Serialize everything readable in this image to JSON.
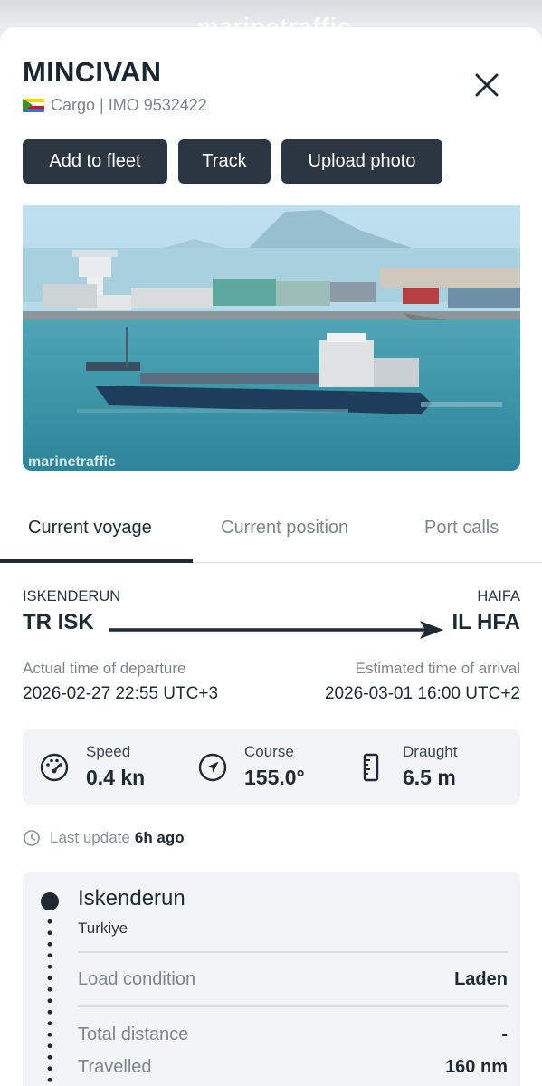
{
  "watermark_top": "marinetraffic",
  "vessel": {
    "name": "MINCIVAN",
    "type": "Cargo",
    "separator": "|",
    "imo_label": "IMO",
    "imo_number": "9532422",
    "flag_icon": "comoros-flag-icon"
  },
  "actions": {
    "add_to_fleet": "Add to fleet",
    "track": "Track",
    "upload_photo": "Upload photo"
  },
  "photo": {
    "watermark": "marinetraffic"
  },
  "tabs": [
    {
      "label": "Current voyage",
      "active": true
    },
    {
      "label": "Current position",
      "active": false
    },
    {
      "label": "Port calls",
      "active": false
    }
  ],
  "voyage": {
    "departure_port": "ISKENDERUN",
    "arrival_port": "HAIFA",
    "departure_code": "TR ISK",
    "arrival_code": "IL HFA",
    "atd_label": "Actual time of departure",
    "atd_value": "2026-02-27 22:55 UTC+3",
    "eta_label": "Estimated time of arrival",
    "eta_value": "2026-03-01 16:00 UTC+2"
  },
  "stats": {
    "speed_label": "Speed",
    "speed_value": "0.4 kn",
    "course_label": "Course",
    "course_value": "155.0°",
    "draught_label": "Draught",
    "draught_value": "6.5 m"
  },
  "last_update": {
    "label": "Last update",
    "value": "6h ago"
  },
  "itinerary": {
    "port_name": "Iskenderun",
    "country": "Turkiye",
    "rows": [
      {
        "label": "Load condition",
        "value": "Laden"
      },
      {
        "label": "Total distance",
        "value": "-"
      },
      {
        "label": "Travelled",
        "value": "160 nm"
      }
    ]
  },
  "colors": {
    "button_bg": "#2b3640",
    "text_dark": "#1f2a33",
    "text_muted": "#7e868d",
    "card_bg": "#f3f4f5"
  }
}
